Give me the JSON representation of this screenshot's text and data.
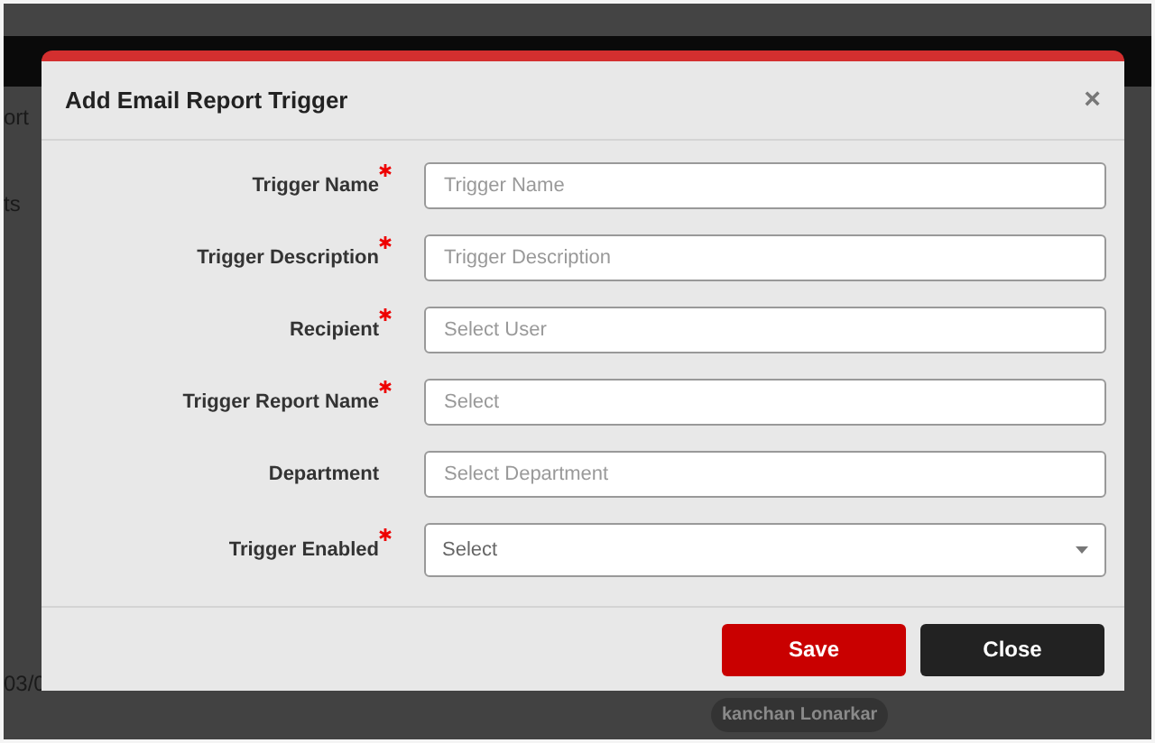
{
  "background": {
    "left_texts": [
      "ort",
      "ts"
    ],
    "date_fragment": "03/0",
    "tag": "kanchan Lonarkar"
  },
  "dialog": {
    "title": "Add Email Report Trigger",
    "close_symbol": "×",
    "fields": [
      {
        "label": "Trigger Name",
        "required": true,
        "placeholder": "Trigger Name",
        "kind": "text"
      },
      {
        "label": "Trigger Description",
        "required": true,
        "placeholder": "Trigger Description",
        "kind": "text"
      },
      {
        "label": "Recipient",
        "required": true,
        "placeholder": "Select User",
        "kind": "text"
      },
      {
        "label": "Trigger Report Name",
        "required": true,
        "placeholder": "Select",
        "kind": "text"
      },
      {
        "label": "Department",
        "required": false,
        "placeholder": "Select Department",
        "kind": "text"
      },
      {
        "label": "Trigger Enabled",
        "required": true,
        "placeholder": "Select",
        "kind": "dropdown"
      }
    ],
    "buttons": [
      {
        "label": "Save",
        "kind": "primary"
      },
      {
        "label": "Close",
        "kind": "secondary"
      }
    ]
  }
}
